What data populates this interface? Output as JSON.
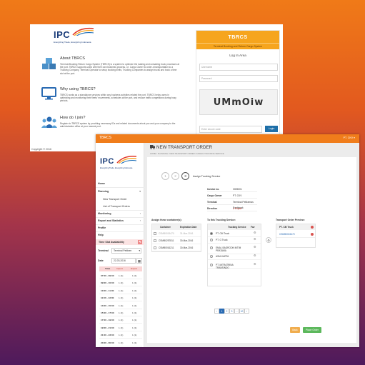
{
  "back": {
    "brand": "IPC",
    "tagline": "Energizing Trade, Energizing Indonesia",
    "sections": [
      {
        "title": "About TBRCS",
        "text": "Terminal Booking Return Cargo System (TBRCS) is a system to optimize the loading and unloading truck processes at the port. TBRCS supports users with their own business process, i.e. Cargo Owner to order a transportation to a Trucking Company, Terminal Operator to setup booking limits, Trucking Companies to assign trucks and book a time slot at the port."
      },
      {
        "title": "Why using TBRCS?",
        "text": "TBRCS works as a standalone services within any business activities related the port. TBRCS helps users in optimizing and monitoring their fleets' movements, schedules at the port, and reduce traffic congestions during busy periods."
      },
      {
        "title": "How do I join?",
        "text": "Register to TBRCS system by providing necessary IDs and related documents about you and your company to the administration office at your nearest port."
      }
    ],
    "copyright": "Copyright © 2016",
    "login": {
      "title": "TBRCS",
      "subtitle": "Terminal Booking and Return Cargo System",
      "area": "Log In Area",
      "username_ph": "Username",
      "password_ph": "Password",
      "captcha": "UMmOiw",
      "code_ph": "Enter secure code",
      "button": "Login"
    }
  },
  "front": {
    "app": "TBRCS",
    "user": "PT. CKV ▾",
    "brand": "IPC",
    "tagline": "Energizing Trade, Energizing Indonesia",
    "nav": {
      "home": "Home",
      "planning": "Planning",
      "new_order": "New Transport Order",
      "list_orders": "List of Transport Orders",
      "monitoring": "Monitoring",
      "reports": "Report and Statistics",
      "profile": "Profile",
      "help": "Help"
    },
    "tsa": {
      "title": "Time Slot Availability",
      "terminal_label": "Terminal",
      "terminal_value": "Terminal Petikem",
      "date_label": "Date",
      "date_value": "22-03-2016",
      "headers": [
        "Time",
        "Import",
        "Export"
      ],
      "rows": [
        [
          "07:00 - 09:00",
          "1 (1)",
          "1 (1)"
        ],
        [
          "09:00 - 10:00",
          "1 (1)",
          "1 (1)"
        ],
        [
          "10:00 - 11:00",
          "1 (1)",
          "1 (1)"
        ],
        [
          "11:00 - 13:00",
          "1 (1)",
          "1 (1)"
        ],
        [
          "13:00 - 15:00",
          "1 (1)",
          "1 (1)"
        ],
        [
          "15:00 - 17:00",
          "1 (1)",
          "1 (1)"
        ],
        [
          "17:00 - 19:00",
          "1 (1)",
          "1 (1)"
        ],
        [
          "19:00 - 21:00",
          "1 (1)",
          "1 (1)"
        ],
        [
          "21:00 - 23:00",
          "1 (1)",
          "1 (1)"
        ],
        [
          "23:00 - 00:00",
          "1 (1)",
          "1 (1)"
        ]
      ]
    },
    "page_title": "NEW TRANSPORT ORDER",
    "breadcrumb": "HOME  /  PLANNING  /  NEW TRANSPORT ORDER  /  ASSIGN TRUCKING SERVICE",
    "steps": [
      "1",
      "2",
      "3"
    ],
    "step_label": "Assign Trucking Service",
    "info": [
      [
        "Invoice no.",
        "0005001"
      ],
      [
        "Cargo Owner",
        "PT. CKV"
      ],
      [
        "Terminal",
        "Terminal Petikemas Pontianak"
      ],
      [
        "Direction",
        "● Export"
      ]
    ],
    "containers": {
      "heading": "Assign these container(s):",
      "headers": [
        "Container",
        "Expiration Date"
      ],
      "rows": [
        [
          "CSMB0015470",
          "31-Mar-2016"
        ],
        [
          "CSMB0257811",
          "30-Mar-2016"
        ],
        [
          "CSMB0016211",
          "30-Mar-2016"
        ]
      ]
    },
    "trucking": {
      "heading": "To this Trucking Service:",
      "headers": [
        "Trucking Service",
        "Fav"
      ],
      "rows": [
        "PT. CM Truck",
        "PT. G Truck",
        "EMAL BAGROON INTIM PRATAMA",
        "ASIA KARTA",
        "PT. MITRATRINA TRANSINDO"
      ]
    },
    "preview": {
      "heading": "Transport Order Preview:",
      "header": "PT. CM Truck",
      "item": "CSMB0015470"
    },
    "pages": [
      "‹",
      "1",
      "2",
      "3",
      "...",
      "10",
      "›"
    ],
    "back_button": "Back",
    "place_button": "Place Order",
    "colors": {
      "orange": "#f07d1b",
      "primary": "#2a6bb3",
      "green": "#5cb85c",
      "danger": "#d9534f"
    }
  }
}
